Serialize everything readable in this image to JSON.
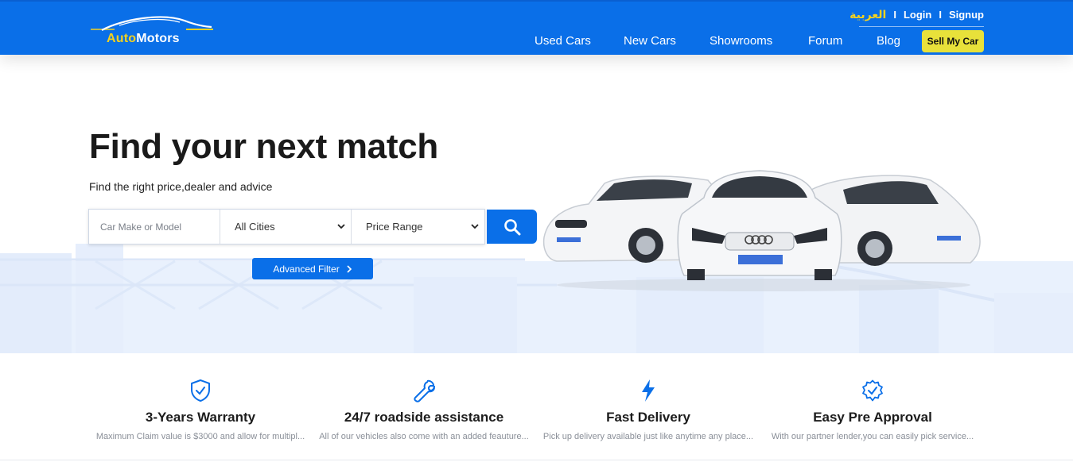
{
  "brand": {
    "logo_part1": "Auto",
    "logo_part2": "Motors"
  },
  "header": {
    "lang_link": "العربية",
    "login": "Login",
    "signup": "Signup",
    "separator": "I",
    "nav": [
      "Used Cars",
      "New Cars",
      "Showrooms",
      "Forum",
      "Blog"
    ],
    "sell_button": "Sell My Car"
  },
  "hero": {
    "title_bold": "Find",
    "title_rest": " your next match",
    "subtitle": "Find the right price,dealer and advice",
    "search": {
      "make_placeholder": "Car Make or Model",
      "city_value": "All Cities",
      "price_value": "Price Range"
    },
    "advanced_filter": "Advanced Filter"
  },
  "features": [
    {
      "icon": "shield-check-icon",
      "title": "3-Years Warranty",
      "description": "Maximum Claim value is $3000 and allow for multipl..."
    },
    {
      "icon": "wrench-icon",
      "title": "24/7 roadside assistance",
      "description": "All of our vehicles also come with an added feauture..."
    },
    {
      "icon": "lightning-icon",
      "title": "Fast Delivery",
      "description": "Pick up delivery available just like anytime any place..."
    },
    {
      "icon": "badge-check-icon",
      "title": "Easy Pre Approval",
      "description": "With our partner lender,you can easily pick service..."
    }
  ],
  "colors": {
    "primary": "#0a6fe8",
    "accent": "#e8e13a",
    "brand_yellow": "#f4d21f"
  }
}
